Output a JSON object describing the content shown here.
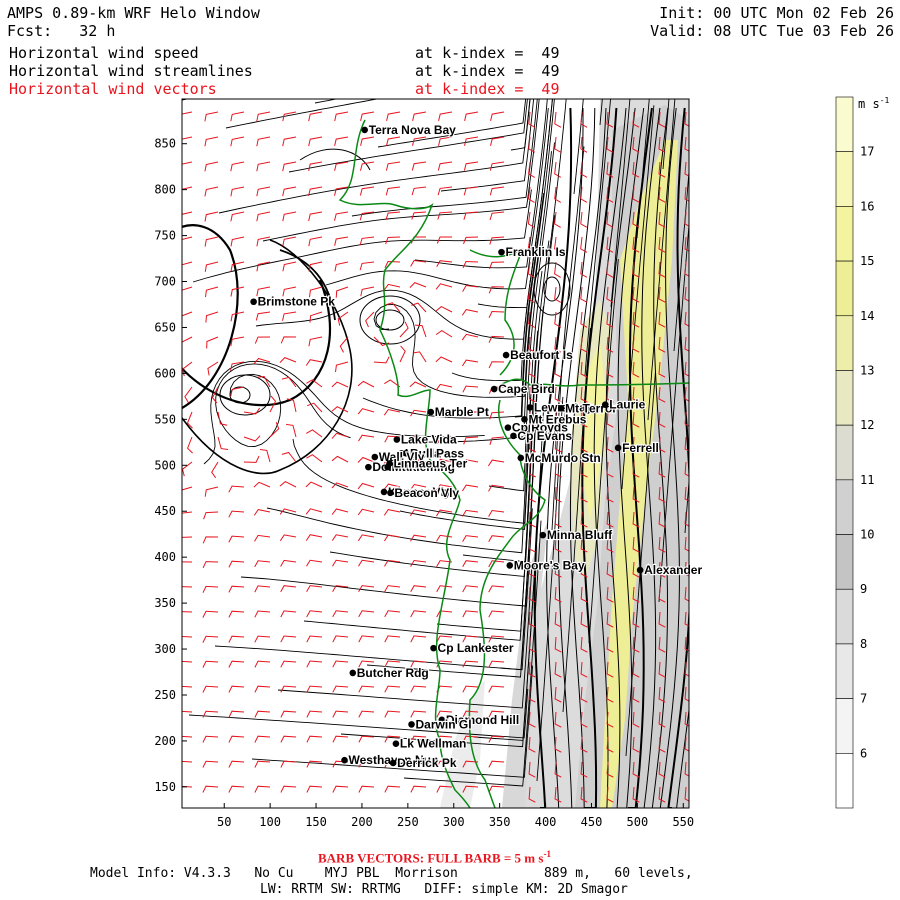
{
  "header": {
    "title": "AMPS 0.89-km WRF Helo Window",
    "fcst_label": "Fcst:",
    "fcst_value": "32 h",
    "init": "Init: 00 UTC Mon 02 Feb 26",
    "valid": "Valid: 08 UTC Tue 03 Feb 26",
    "fields": [
      {
        "name": "Horizontal wind speed",
        "level": "at k-index =  49"
      },
      {
        "name": "Horizontal wind streamlines",
        "level": "at k-index =  49"
      },
      {
        "name": "Horizontal wind vectors",
        "level": "at k-index =  49"
      }
    ]
  },
  "axes": {
    "x_ticks": [
      "50",
      "100",
      "150",
      "200",
      "250",
      "300",
      "350",
      "400",
      "450",
      "500",
      "550"
    ],
    "y_ticks": [
      "850",
      "800",
      "750",
      "700",
      "650",
      "600",
      "550",
      "500",
      "450",
      "400",
      "350",
      "300",
      "250",
      "200",
      "150"
    ]
  },
  "colorbar": {
    "unit": "m s",
    "unit_exp": "-1",
    "labels": [
      "17",
      "16",
      "15",
      "14",
      "13",
      "12",
      "11",
      "10",
      "9",
      "8",
      "7",
      "6"
    ],
    "colors": [
      "#fbfbd0",
      "#f7f7b8",
      "#f3f3a0",
      "#eeee96",
      "#eeeeab",
      "#e8e8c2",
      "#dcdcd0",
      "#d0d0d0",
      "#c4c4c4",
      "#dadada",
      "#e8e8e8",
      "#f4f4f4",
      "#ffffff"
    ]
  },
  "stations": [
    {
      "name": "Terra Nova Bay",
      "x": 203,
      "y": 865
    },
    {
      "name": "Franklin Is",
      "x": 352,
      "y": 732
    },
    {
      "name": "Brimstone Pk",
      "x": 82,
      "y": 678
    },
    {
      "name": "Beaufort Is",
      "x": 357,
      "y": 620
    },
    {
      "name": "Cape Bird",
      "x": 344,
      "y": 583
    },
    {
      "name": "Lewis Bay",
      "x": 383,
      "y": 563
    },
    {
      "name": "Mt Terror",
      "x": 417,
      "y": 562
    },
    {
      "name": "Laurie",
      "x": 465,
      "y": 566
    },
    {
      "name": "Marble Pt",
      "x": 275,
      "y": 558
    },
    {
      "name": "Cp Royds",
      "x": 359,
      "y": 541
    },
    {
      "name": "Mt Erebus",
      "x": 377,
      "y": 550
    },
    {
      "name": "Cp Evans",
      "x": 365,
      "y": 532
    },
    {
      "name": "Lake Vida",
      "x": 238,
      "y": 528
    },
    {
      "name": "Ferrell",
      "x": 479,
      "y": 519
    },
    {
      "name": "Vanda",
      "x": 243,
      "y": 513
    },
    {
      "name": "Bull Pass",
      "x": 248,
      "y": 513
    },
    {
      "name": "Wall Vly",
      "x": 214,
      "y": 509
    },
    {
      "name": "McMurdo Stn",
      "x": 373,
      "y": 508
    },
    {
      "name": "Don Juan",
      "x": 207,
      "y": 498
    },
    {
      "name": "Mt Fleming",
      "x": 228,
      "y": 498
    },
    {
      "name": "Linnaeus Ter",
      "x": 230,
      "y": 502
    },
    {
      "name": "Kennar Vly",
      "x": 224,
      "y": 471
    },
    {
      "name": "Beacon Vly",
      "x": 231,
      "y": 470
    },
    {
      "name": "Minna Bluff",
      "x": 397,
      "y": 424
    },
    {
      "name": "Moore's Bay",
      "x": 361,
      "y": 391
    },
    {
      "name": "Alexander",
      "x": 503,
      "y": 386
    },
    {
      "name": "Cp Lankester",
      "x": 278,
      "y": 301
    },
    {
      "name": "Butcher Rdg",
      "x": 190,
      "y": 274
    },
    {
      "name": "Diamond Hill",
      "x": 287,
      "y": 223
    },
    {
      "name": "Darwin Gl",
      "x": 254,
      "y": 218
    },
    {
      "name": "Lk Wellman",
      "x": 237,
      "y": 197
    },
    {
      "name": "Westhaven Nun",
      "x": 181,
      "y": 179
    },
    {
      "name": "Derrick Pk",
      "x": 234,
      "y": 176
    }
  ],
  "footer": {
    "barb_prefix": "BARB VECTORS:  FULL BARB = 5 m s",
    "barb_exp": "-1",
    "line1": "Model Info: V4.3.3   No Cu    MYJ PBL  Morrison           889 m,   60 levels,",
    "line2": "LW: RRTM SW: RRTMG   DIFF: simple KM: 2D Smagor"
  }
}
